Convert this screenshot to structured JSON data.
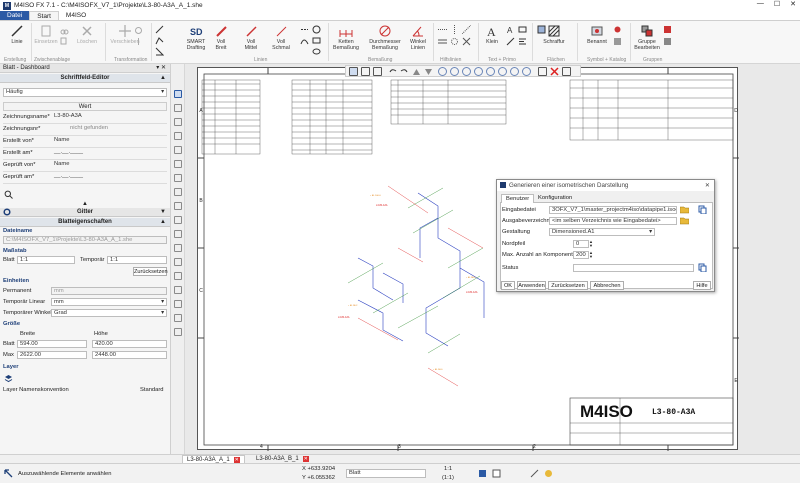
{
  "window": {
    "title": "M4ISO FX 7.1 - C:\\M4ISOFX_V7_1\\Projekte\\L3-80-A3A_A_1.she",
    "minimize": "—",
    "maximize": "☐",
    "close": "✕"
  },
  "tabs": [
    "Datei",
    "Start",
    "M4ISO"
  ],
  "ribbon": {
    "linie": "Linie",
    "erstellung": "Erstellung",
    "einsetzen": "Einsetzen",
    "loeschen": "Löschen",
    "zwischenablage": "Zwischenablage",
    "verschieben": "Verschieben",
    "transformation": "Transformation",
    "smart": "SMART Drafting",
    "vollbreit": "Voll Breit",
    "vollmittel": "Voll Mittel",
    "vollschmal": "Voll Schmal",
    "linien": "Linien",
    "kettenbem": "Ketten Bemaßung",
    "durchmesser": "Durchmesser Bemaßung",
    "winkellinien": "Winkel Linien",
    "bemassung": "Bemaßung",
    "hilfslinien": "Hilfslinien",
    "klein": "Klein",
    "textprimo": "Text + Primo",
    "schraffur": "Schraffur",
    "flaechen": "Flächen",
    "benannt": "Benannt",
    "symbolkatalog": "Symbol + Katalog",
    "gruppe": "Gruppe Bearbeiten",
    "gruppen": "Gruppen"
  },
  "leftpanel": {
    "title": "Blatt - Dashboard",
    "section1": "Schriftfeld-Editor",
    "filter": "Häufig",
    "wert": "Wert",
    "fields": [
      {
        "label": "Zeichnungsname*",
        "value": "L3-80-A3A"
      },
      {
        "label": "Zeichnungsnr*",
        "value": "nicht gefunden"
      },
      {
        "label": "Erstellt von*",
        "value": "Name"
      },
      {
        "label": "Erstellt am*",
        "value": "__.__.____"
      },
      {
        "label": "Geprüft von*",
        "value": "Name"
      },
      {
        "label": "Geprüft am*",
        "value": "__.__.____"
      }
    ],
    "gitter": "Gitter",
    "section2": "Blatteigenschaften",
    "dateiname_h": "Dateiname",
    "dateiname": "C:\\M4ISOFX_V7_1\\Projekte\\L3-80-A3A_A_1.she",
    "massstab_h": "Maßstab",
    "blatt_label": "Blatt",
    "blatt_value": "1:1",
    "temp_label": "Temporär",
    "temp_value": "1:1",
    "reset": "Zurücksetzen",
    "einheiten_h": "Einheiten",
    "permanent_label": "Permanent",
    "permanent_value": "mm",
    "templin_label": "Temporär Linear",
    "templin_value": "mm",
    "tempwin_label": "Temporärer Winkel",
    "tempwin_value": "Grad",
    "groesse_h": "Größe",
    "breite": "Breite",
    "hoehe": "Höhe",
    "gblatt_label": "Blatt",
    "gblatt_b": "594.00",
    "gblatt_h": "420.00",
    "gmax_label": "Max",
    "gmax_b": "2622.00",
    "gmax_h": "2448.00",
    "layer_h": "Layer",
    "layer_label": "Layer Namenskonvention",
    "layer_value": "Standard"
  },
  "drawing": {
    "title_block_name": "L3-80-A3A",
    "logo_text": "M4ISO",
    "row_letters": [
      "A",
      "B",
      "C",
      "D",
      "E"
    ],
    "col_numbers": [
      "4",
      "3",
      "2"
    ]
  },
  "dialog": {
    "title": "Generieren einer isometrischen Darstellung",
    "tab1": "Benutzer",
    "tab2": "Konfiguration",
    "eingabe_label": "Eingabedatei",
    "eingabe_value": "3OFX_V7_1\\master_projectm4iso\\datapipe1.isoo",
    "ausgabe_label": "Ausgabeverzeichnis",
    "ausgabe_value": "<im selben Verzeichnis wie Eingabedatei>",
    "gestaltung_label": "Gestaltung",
    "gestaltung_value": "Dimensioned.A1",
    "nordpfeil_label": "Nordpfeil",
    "nordpfeil_value": "0",
    "maxanz_label": "Max. Anzahl an Komponenten",
    "maxanz_value": "200",
    "status_label": "Status",
    "ok": "OK",
    "anwenden": "Anwenden",
    "zurueck": "Zurücksetzen",
    "abbrechen": "Abbrechen",
    "hilfe": "Hilfe"
  },
  "doctabs": [
    "L3-80-A3A_A_1",
    "L3-80-A3A_B_1"
  ],
  "status": {
    "hint": "Auszuwählende Elemente anwählen",
    "x": "X +633.9204",
    "y": "Y +6.055362",
    "blatt": "Blatt",
    "scale1": "1:1",
    "scale2": "(1:1)"
  },
  "colors": {
    "accent": "#2b5aa5",
    "iso_red": "#d22",
    "iso_blue": "#2a3fc0",
    "iso_green": "#2a8a2a",
    "iso_orange": "#e07a00"
  }
}
